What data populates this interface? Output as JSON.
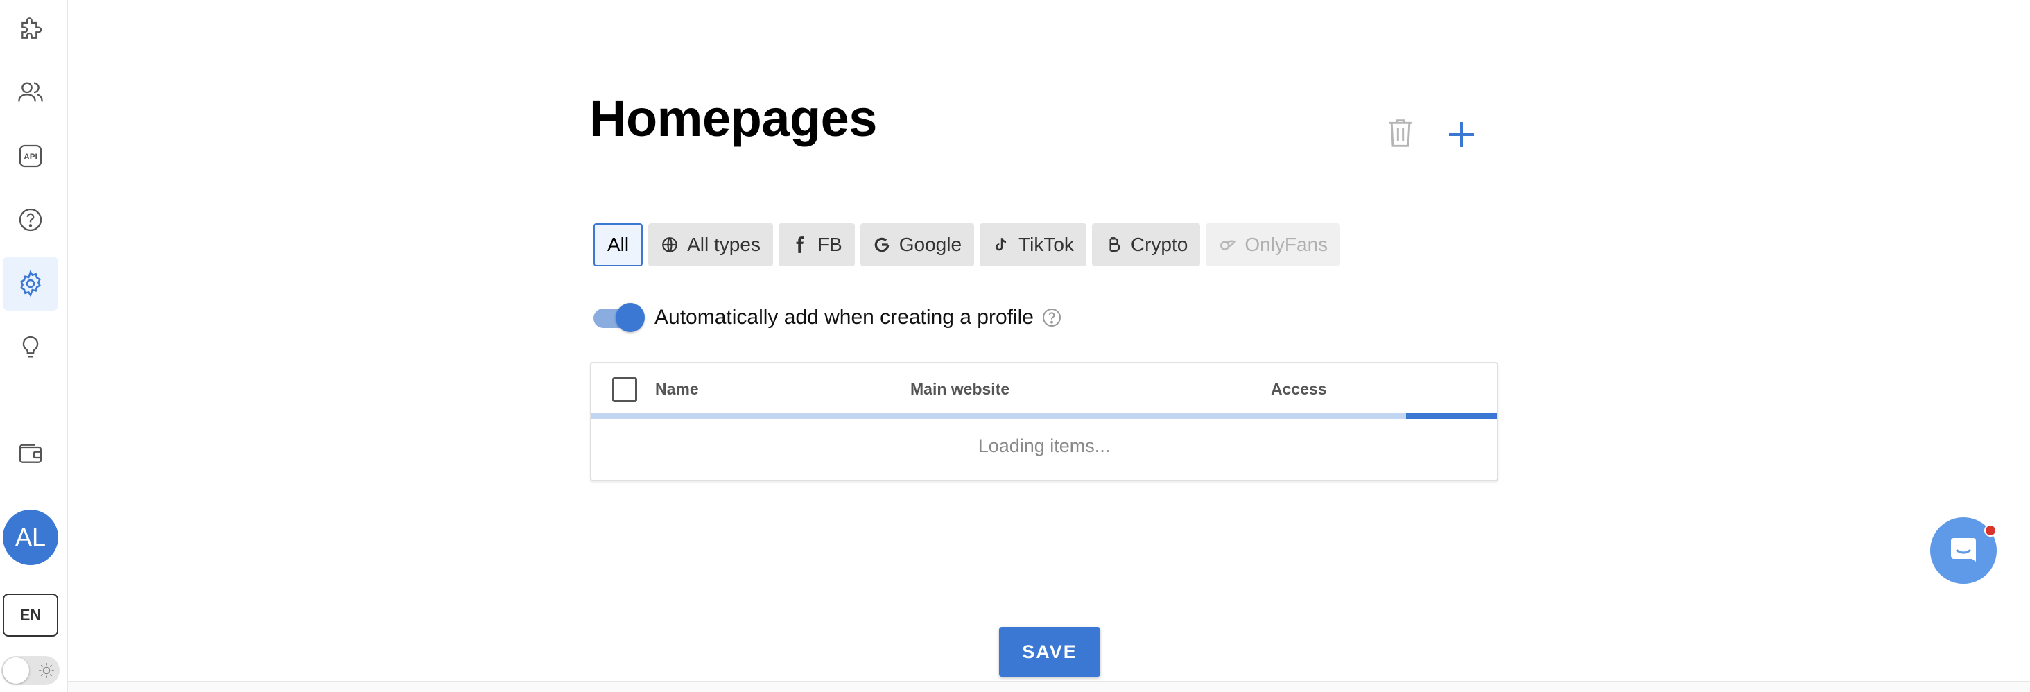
{
  "sidebar": {
    "items": [
      {
        "icon": "puzzle-icon"
      },
      {
        "icon": "users-icon"
      },
      {
        "icon": "api-icon",
        "label": "API"
      },
      {
        "icon": "help-circle-icon"
      },
      {
        "icon": "gear-icon",
        "active": true
      },
      {
        "icon": "lightbulb-icon"
      },
      {
        "icon": "wallet-icon"
      }
    ],
    "avatar_initials": "AL",
    "language": "EN",
    "theme_icon": "sun-icon"
  },
  "page": {
    "title": "Homepages",
    "trash_icon": "trash-icon",
    "add_icon": "plus-icon"
  },
  "filters": {
    "chips": [
      {
        "label": "All",
        "icon": null,
        "selected": true
      },
      {
        "label": "All types",
        "icon": "globe-icon"
      },
      {
        "label": "FB",
        "icon": "facebook-icon"
      },
      {
        "label": "Google",
        "icon": "google-icon"
      },
      {
        "label": "TikTok",
        "icon": "tiktok-icon"
      },
      {
        "label": "Crypto",
        "icon": "bitcoin-icon"
      },
      {
        "label": "OnlyFans",
        "icon": "onlyfans-icon",
        "disabled": true
      }
    ]
  },
  "auto_add": {
    "label": "Automatically add when creating a profile",
    "enabled": true
  },
  "table": {
    "columns": [
      "Name",
      "Main website",
      "Access"
    ],
    "loading_text": "Loading items...",
    "progress_fraction": 0.1
  },
  "actions": {
    "save_label": "SAVE"
  },
  "colors": {
    "accent": "#3a78d3",
    "chip_bg": "#e5e5e5",
    "notification": "#d9342b"
  }
}
